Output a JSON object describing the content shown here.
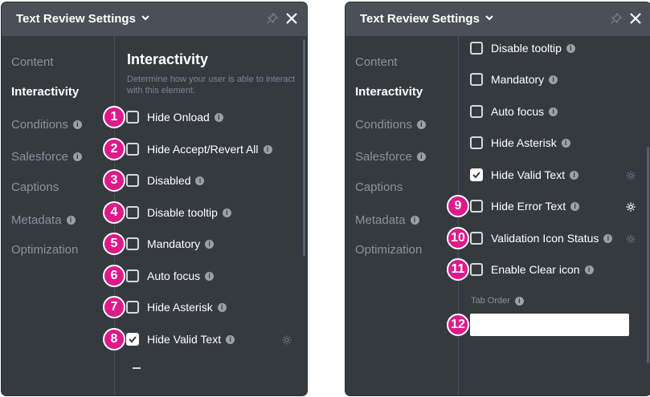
{
  "left": {
    "title": "Text Review Settings",
    "sidebar": [
      {
        "label": "Content",
        "info": false,
        "active": false
      },
      {
        "label": "Interactivity",
        "info": false,
        "active": true
      },
      {
        "label": "Conditions",
        "info": true,
        "active": false
      },
      {
        "label": "Salesforce",
        "info": true,
        "active": false
      },
      {
        "label": "Captions",
        "info": false,
        "active": false
      },
      {
        "label": "Metadata",
        "info": true,
        "active": false
      },
      {
        "label": "Optimization",
        "info": false,
        "active": false
      }
    ],
    "section_title": "Interactivity",
    "section_desc": "Determine how your user is able to interact with this element.",
    "options": [
      {
        "badge": "1",
        "label": "Hide Onload",
        "checked": false,
        "gear": false
      },
      {
        "badge": "2",
        "label": "Hide Accept/Revert All",
        "checked": false,
        "gear": false
      },
      {
        "badge": "3",
        "label": "Disabled",
        "checked": false,
        "gear": false
      },
      {
        "badge": "4",
        "label": "Disable tooltip",
        "checked": false,
        "gear": false
      },
      {
        "badge": "5",
        "label": "Mandatory",
        "checked": false,
        "gear": false
      },
      {
        "badge": "6",
        "label": "Auto focus",
        "checked": false,
        "gear": false
      },
      {
        "badge": "7",
        "label": "Hide Asterisk",
        "checked": false,
        "gear": false
      },
      {
        "badge": "8",
        "label": "Hide Valid Text",
        "checked": true,
        "gear": true
      }
    ]
  },
  "right": {
    "title": "Text Review Settings",
    "sidebar": [
      {
        "label": "Content",
        "info": false,
        "active": false
      },
      {
        "label": "Interactivity",
        "info": false,
        "active": true
      },
      {
        "label": "Conditions",
        "info": true,
        "active": false
      },
      {
        "label": "Salesforce",
        "info": true,
        "active": false
      },
      {
        "label": "Captions",
        "info": false,
        "active": false
      },
      {
        "label": "Metadata",
        "info": true,
        "active": false
      },
      {
        "label": "Optimization",
        "info": false,
        "active": false
      }
    ],
    "options": [
      {
        "badge": "",
        "label": "Disable tooltip",
        "checked": false,
        "gear": false
      },
      {
        "badge": "",
        "label": "Mandatory",
        "checked": false,
        "gear": false
      },
      {
        "badge": "",
        "label": "Auto focus",
        "checked": false,
        "gear": false
      },
      {
        "badge": "",
        "label": "Hide Asterisk",
        "checked": false,
        "gear": false
      },
      {
        "badge": "",
        "label": "Hide Valid Text",
        "checked": true,
        "gear": true
      },
      {
        "badge": "9",
        "label": "Hide Error Text",
        "checked": false,
        "gear": true,
        "gear_bright": true
      },
      {
        "badge": "10",
        "label": "Validation Icon Status",
        "checked": false,
        "gear": true
      },
      {
        "badge": "11",
        "label": "Enable Clear icon",
        "checked": false,
        "gear": false
      }
    ],
    "tab_order": {
      "badge": "12",
      "label": "Tab Order",
      "value": ""
    }
  },
  "colors": {
    "panel": "#353a40",
    "header": "#4a5058",
    "badge": "#e0198b",
    "active_text": "#ffffff",
    "muted_text": "#8b9298"
  },
  "icons": {
    "chevron": "chevron-down-icon",
    "pin": "pin-icon",
    "close": "close-icon",
    "info": "info-icon",
    "gear": "gear-icon",
    "check": "check-icon"
  }
}
